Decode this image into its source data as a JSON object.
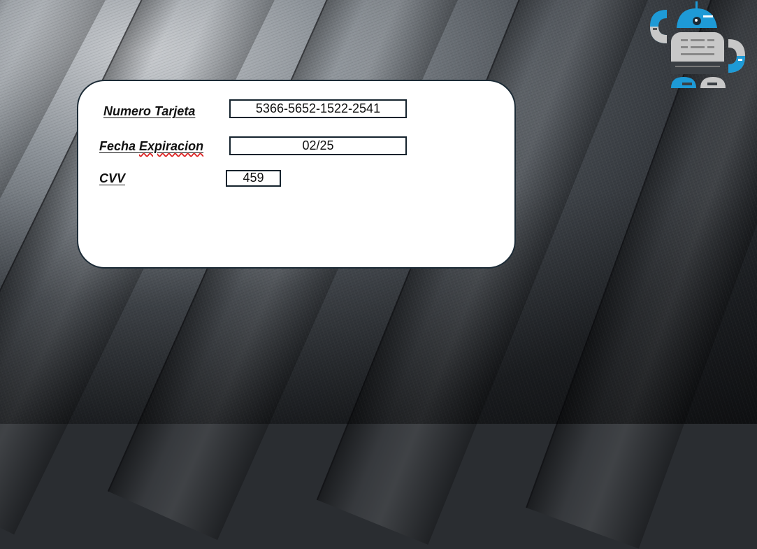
{
  "form": {
    "card_number_label": "Numero Tarjeta",
    "card_number_value": "5366-5652-1522-2541",
    "expiry_label_part1": "Fecha ",
    "expiry_label_part2": "Expiracion",
    "expiry_value": "02/25",
    "cvv_label": "CVV",
    "cvv_value": "459"
  },
  "logo": {
    "icon": "robot-icon",
    "accent_color": "#1e9ad6",
    "body_color": "#c8c8c8"
  },
  "colors": {
    "card_border": "#1c2b36",
    "field_border": "#15232d"
  }
}
